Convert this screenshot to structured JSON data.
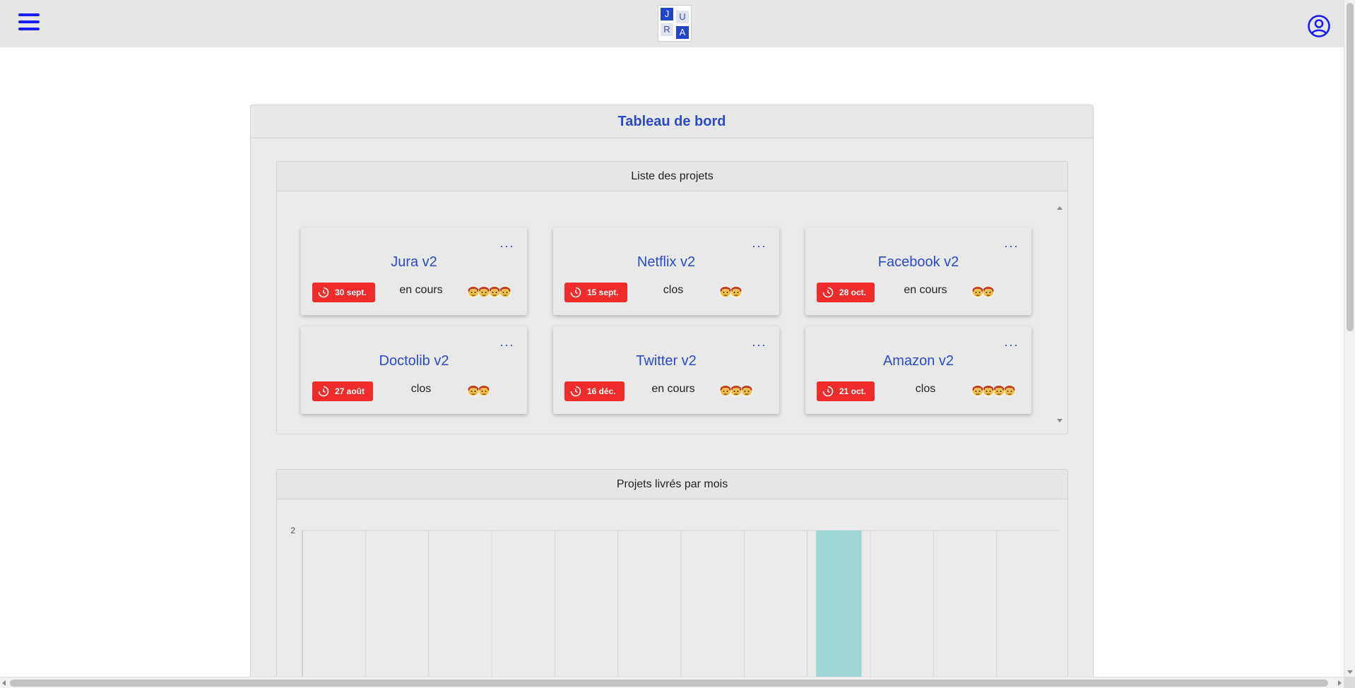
{
  "header": {
    "logo_letters": [
      "J",
      "U",
      "R",
      "A"
    ],
    "menu_icon": "hamburger-menu-icon",
    "user_icon": "user-circle-icon",
    "accent_color": "#1a1aff"
  },
  "dashboard": {
    "title": "Tableau de bord",
    "projects_section": {
      "title": "Liste des projets",
      "projects": [
        {
          "name": "Jura v2",
          "date": "30 sept.",
          "status": "en cours",
          "members": 4
        },
        {
          "name": "Netflix v2",
          "date": "15 sept.",
          "status": "clos",
          "members": 2
        },
        {
          "name": "Facebook v2",
          "date": "28 oct.",
          "status": "en cours",
          "members": 2
        },
        {
          "name": "Doctolib v2",
          "date": "27 août",
          "status": "clos",
          "members": 2
        },
        {
          "name": "Twitter v2",
          "date": "16 déc.",
          "status": "en cours",
          "members": 3
        },
        {
          "name": "Amazon v2",
          "date": "21 oct.",
          "status": "clos",
          "members": 4
        }
      ],
      "menu_label": "···",
      "date_badge_color": "#ef2b2b",
      "title_color": "#2b4acb"
    },
    "chart_section": {
      "title": "Projets livrés par mois"
    }
  },
  "chart_data": {
    "type": "bar",
    "categories": [
      "",
      "",
      "",
      "",
      "",
      "",
      "",
      "",
      "",
      "",
      "",
      ""
    ],
    "values": [
      0,
      0,
      0,
      0,
      0,
      0,
      0,
      0,
      2,
      0,
      0,
      0
    ],
    "title": "Projets livrés par mois",
    "xlabel": "",
    "ylabel": "",
    "ytick_labels": [
      "2"
    ],
    "ylim": [
      0,
      2
    ],
    "grid": true,
    "bar_color": "#9fd6d6"
  }
}
